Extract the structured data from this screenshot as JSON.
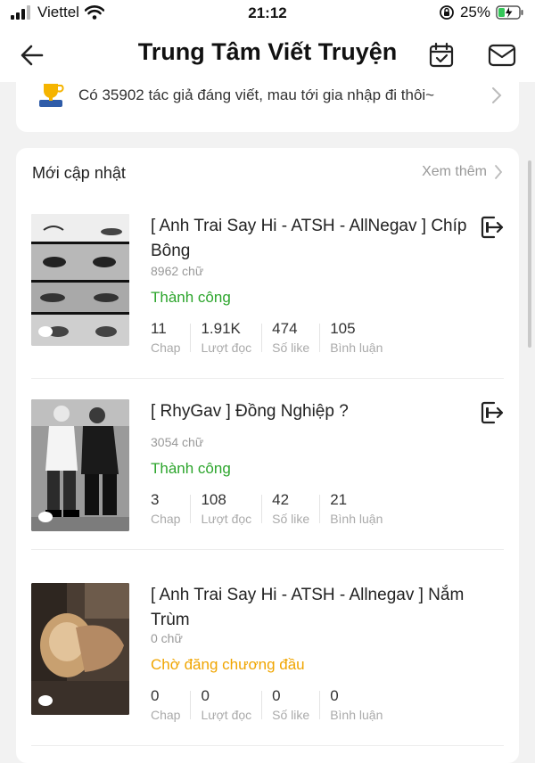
{
  "status_bar": {
    "carrier": "Viettel",
    "time": "21:12",
    "battery": "25%"
  },
  "header": {
    "title": "Trung Tâm Viết Truyện"
  },
  "banner": {
    "text": "Có 35902 tác giả đáng viết, mau tới gia nhập đi thôi~"
  },
  "section": {
    "title": "Mới cập nhật",
    "see_more": "Xem thêm"
  },
  "stat_labels": {
    "chap": "Chap",
    "reads": "Lượt đọc",
    "likes": "Số like",
    "comments": "Bình luận"
  },
  "stories": [
    {
      "title": "[ Anh Trai Say Hi - ATSH - AllNegav ] Chíp Bông",
      "words": "8962 chữ",
      "status": "Thành công",
      "status_color": "#2ca52c",
      "chap": "11",
      "reads": "1.91K",
      "likes": "474",
      "comments": "105"
    },
    {
      "title": "[ RhyGav ] Đồng Nghiệp ?",
      "words": "3054 chữ",
      "status": "Thành công",
      "status_color": "#2ca52c",
      "chap": "3",
      "reads": "108",
      "likes": "42",
      "comments": "21"
    },
    {
      "title": "[ Anh Trai Say Hi - ATSH - Allnegav ] Nắm Trùm",
      "words": "0 chữ",
      "status": "Chờ đăng chương đầu",
      "status_color": "#f0a500",
      "chap": "0",
      "reads": "0",
      "likes": "0",
      "comments": "0"
    }
  ]
}
